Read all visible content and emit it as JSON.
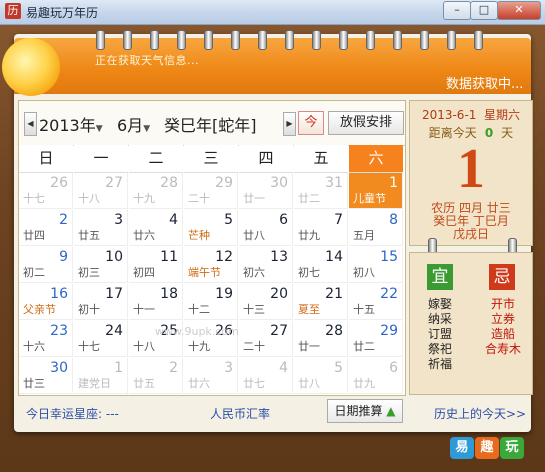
{
  "window": {
    "title": "易趣玩万年历",
    "icon": "历",
    "min": "–",
    "max": "□",
    "close": "✕"
  },
  "weather": {
    "status": "正在获取天气信息...",
    "fetching": "数据获取中..."
  },
  "nav": {
    "prev": "◀",
    "next": "▶",
    "year": "2013年",
    "month": "6月",
    "ganzhi": "癸巳年[蛇年]",
    "today_label": "今",
    "holiday_button": "放假安排"
  },
  "weekdays": [
    "日",
    "一",
    "二",
    "三",
    "四",
    "五",
    "六"
  ],
  "weeks": [
    [
      {
        "d": "26",
        "l": "十七",
        "o": true
      },
      {
        "d": "27",
        "l": "十八",
        "o": true
      },
      {
        "d": "28",
        "l": "十九",
        "o": true
      },
      {
        "d": "29",
        "l": "二十",
        "o": true
      },
      {
        "d": "30",
        "l": "廿一",
        "o": true
      },
      {
        "d": "31",
        "l": "廿二",
        "o": true
      },
      {
        "d": "1",
        "l": "儿童节",
        "t": true
      }
    ],
    [
      {
        "d": "2",
        "l": "廿四"
      },
      {
        "d": "3",
        "l": "廿五"
      },
      {
        "d": "4",
        "l": "廿六"
      },
      {
        "d": "5",
        "l": "芒种",
        "f": true
      },
      {
        "d": "6",
        "l": "廿八"
      },
      {
        "d": "7",
        "l": "廿九"
      },
      {
        "d": "8",
        "l": "五月"
      }
    ],
    [
      {
        "d": "9",
        "l": "初二"
      },
      {
        "d": "10",
        "l": "初三"
      },
      {
        "d": "11",
        "l": "初四"
      },
      {
        "d": "12",
        "l": "端午节",
        "f": true
      },
      {
        "d": "13",
        "l": "初六"
      },
      {
        "d": "14",
        "l": "初七"
      },
      {
        "d": "15",
        "l": "初八"
      }
    ],
    [
      {
        "d": "16",
        "l": "父亲节",
        "f": true
      },
      {
        "d": "17",
        "l": "初十"
      },
      {
        "d": "18",
        "l": "十一"
      },
      {
        "d": "19",
        "l": "十二"
      },
      {
        "d": "20",
        "l": "十三"
      },
      {
        "d": "21",
        "l": "夏至",
        "f": true
      },
      {
        "d": "22",
        "l": "十五"
      }
    ],
    [
      {
        "d": "23",
        "l": "十六"
      },
      {
        "d": "24",
        "l": "十七"
      },
      {
        "d": "25",
        "l": "十八"
      },
      {
        "d": "26",
        "l": "十九"
      },
      {
        "d": "27",
        "l": "二十"
      },
      {
        "d": "28",
        "l": "廿一"
      },
      {
        "d": "29",
        "l": "廿二"
      }
    ],
    [
      {
        "d": "30",
        "l": "廿三"
      },
      {
        "d": "1",
        "l": "建党日",
        "o": true
      },
      {
        "d": "2",
        "l": "廿五",
        "o": true
      },
      {
        "d": "3",
        "l": "廿六",
        "o": true
      },
      {
        "d": "4",
        "l": "廿七",
        "o": true
      },
      {
        "d": "5",
        "l": "廿八",
        "o": true
      },
      {
        "d": "6",
        "l": "廿九",
        "o": true
      }
    ]
  ],
  "watermark": "www.9upk.com",
  "detail": {
    "date": "2013-6-1",
    "weekday": "星期六",
    "dist_label": "距离今天",
    "dist_value": "0",
    "dist_unit": "天",
    "big_day": "1",
    "lunar_line1": "农历  四月  廿三",
    "lunar_line2": "癸巳年  丁巳月",
    "lunar_line3": "戊戌日"
  },
  "yiji": {
    "yi_label": "宜",
    "ji_label": "忌",
    "yi": [
      "嫁娶",
      "纳采",
      "订盟",
      "祭祀",
      "祈福"
    ],
    "ji": [
      "开市",
      "立券",
      "造船",
      "合寿木"
    ]
  },
  "bottom": {
    "constellation": "今日幸运星座: ---",
    "rmb": "人民币汇率",
    "date_calc": "日期推算",
    "history": "历史上的今天>>"
  },
  "logo": [
    "易",
    "趣",
    "玩"
  ]
}
